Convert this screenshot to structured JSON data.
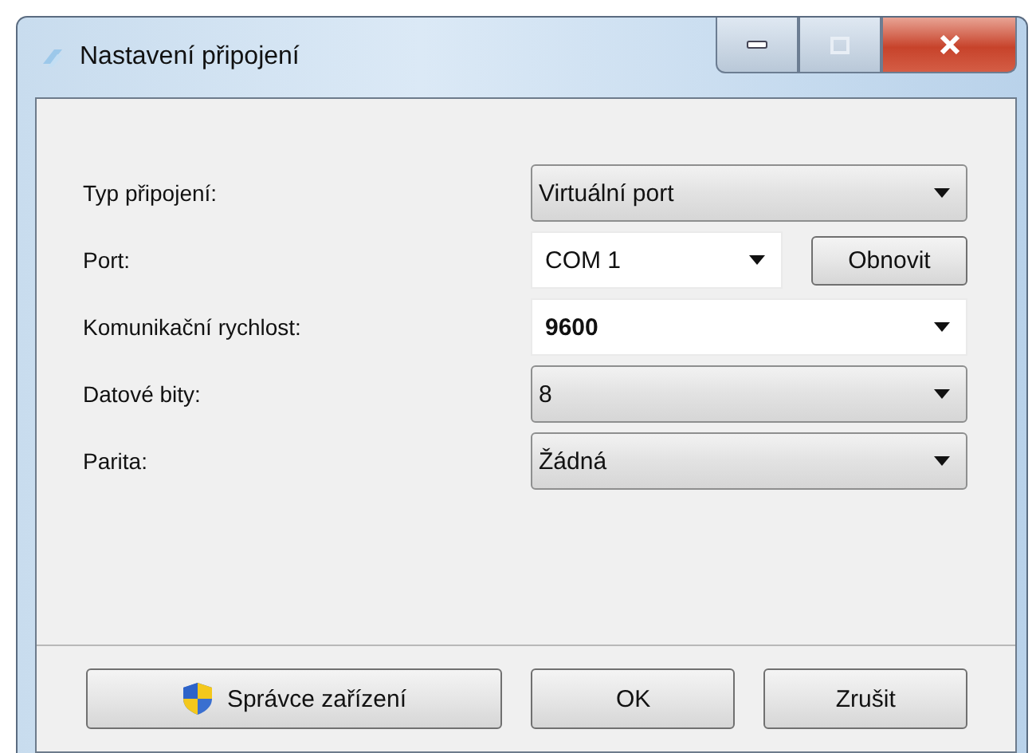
{
  "window": {
    "title": "Nastavení připojení"
  },
  "fields": [
    {
      "label": "Typ připojení:",
      "kind": "dropdown",
      "value": "Virtuální port",
      "bold": false
    },
    {
      "label": "Port:",
      "kind": "combo",
      "value": "COM 1",
      "bold": false,
      "button": "Obnovit"
    },
    {
      "label": "Komunikační rychlost:",
      "kind": "combo",
      "value": "9600",
      "bold": true
    },
    {
      "label": "Datové bity:",
      "kind": "dropdown",
      "value": "8",
      "bold": false
    },
    {
      "label": "Parita:",
      "kind": "dropdown",
      "value": "Žádná",
      "bold": false
    }
  ],
  "buttons": [
    {
      "label": "Správce zařízení",
      "kind": "shield"
    },
    {
      "label": "OK",
      "kind": "plain"
    },
    {
      "label": "Zrušit",
      "kind": "plain"
    }
  ]
}
